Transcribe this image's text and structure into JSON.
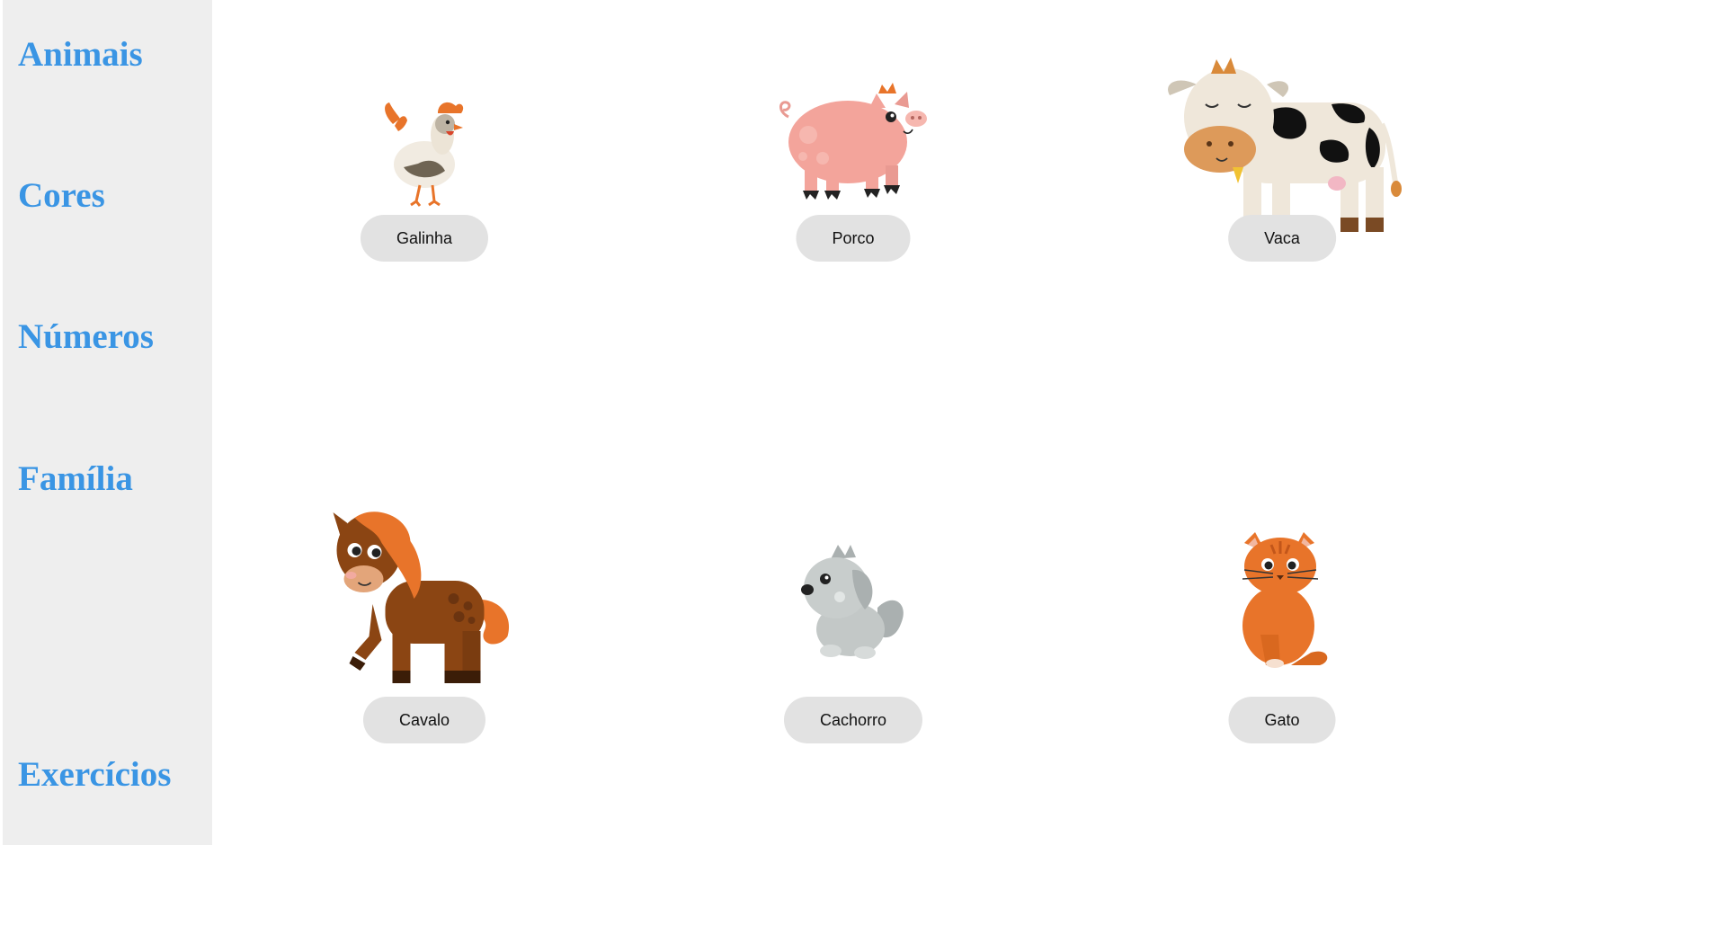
{
  "sidebar": {
    "items": [
      {
        "label": "Animais"
      },
      {
        "label": "Cores"
      },
      {
        "label": "Números"
      },
      {
        "label": "Família"
      },
      {
        "label": "Exercícios"
      }
    ]
  },
  "animals": [
    {
      "label": "Galinha",
      "icon": "chicken-illustration"
    },
    {
      "label": "Porco",
      "icon": "pig-illustration"
    },
    {
      "label": "Vaca",
      "icon": "cow-illustration"
    },
    {
      "label": "Cavalo",
      "icon": "horse-illustration"
    },
    {
      "label": "Cachorro",
      "icon": "dog-illustration"
    },
    {
      "label": "Gato",
      "icon": "cat-illustration"
    }
  ],
  "colors": {
    "link": "#3a95e4",
    "sidebar_bg": "#eeeeee",
    "button_bg": "#e2e2e2"
  }
}
